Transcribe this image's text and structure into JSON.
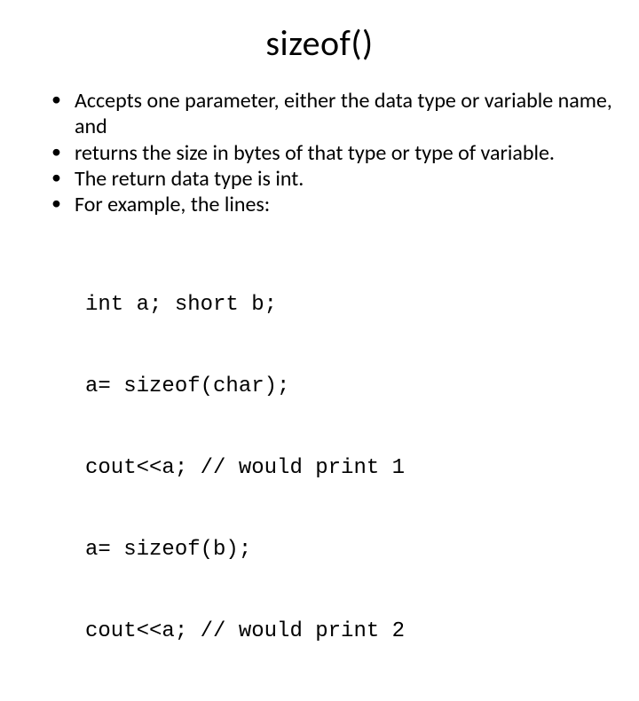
{
  "title": "sizeof()",
  "bullets": [
    "Accepts one parameter, either the data type or variable name, and",
    "returns the size in bytes of that type or type of variable.",
    "The return data type is int.",
    "For example, the lines:"
  ],
  "code": [
    "int a; short b;",
    "a= sizeof(char);",
    "cout<<a; // would print 1",
    "a= sizeof(b);",
    "cout<<a; // would print 2"
  ]
}
